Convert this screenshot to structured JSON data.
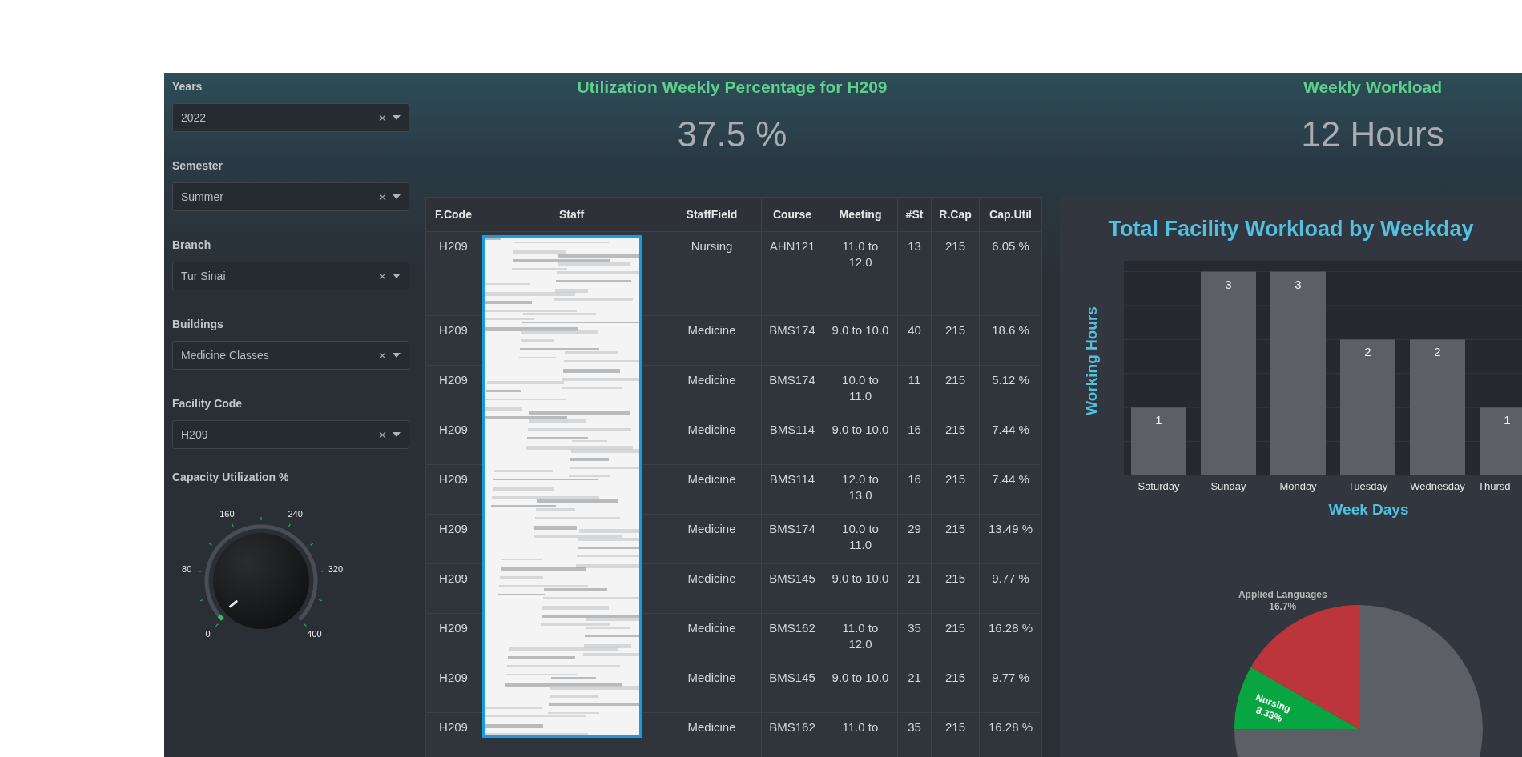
{
  "filters": [
    {
      "label": "Years",
      "value": "2022"
    },
    {
      "label": "Semester",
      "value": "Summer"
    },
    {
      "label": "Branch",
      "value": "Tur Sinai"
    },
    {
      "label": "Buildings",
      "value": "Medicine Classes"
    },
    {
      "label": "Facility Code",
      "value": "H209"
    }
  ],
  "gauge": {
    "label": "Capacity Utilization %",
    "ticks": [
      "0",
      "80",
      "160",
      "240",
      "320",
      "400"
    ],
    "level": 0.02
  },
  "kpis": [
    {
      "title": "Utilization Weekly Percentage for H209",
      "value": "37.5 %"
    },
    {
      "title": "Weekly Workload",
      "value": "12 Hours"
    }
  ],
  "table": {
    "columns": [
      {
        "label": "F.Code"
      },
      {
        "label": "Staff",
        "redacted": true
      },
      {
        "label": "StaffField"
      },
      {
        "label": "Course"
      },
      {
        "label": "Meeting"
      },
      {
        "label": "#St"
      },
      {
        "label": "R.Cap"
      },
      {
        "label": "Cap.Util"
      }
    ],
    "rows": [
      [
        "H209",
        "",
        "Nursing",
        "AHN121",
        "11.0 to 12.0",
        "13",
        "215",
        "6.05 %"
      ],
      [
        "H209",
        "",
        "Medicine",
        "BMS174",
        "9.0 to 10.0",
        "40",
        "215",
        "18.6 %"
      ],
      [
        "H209",
        "",
        "Medicine",
        "BMS174",
        "10.0 to 11.0",
        "11",
        "215",
        "5.12 %"
      ],
      [
        "H209",
        "",
        "Medicine",
        "BMS114",
        "9.0 to 10.0",
        "16",
        "215",
        "7.44 %"
      ],
      [
        "H209",
        "",
        "Medicine",
        "BMS114",
        "12.0 to 13.0",
        "16",
        "215",
        "7.44 %"
      ],
      [
        "H209",
        "",
        "Medicine",
        "BMS174",
        "10.0 to 11.0",
        "29",
        "215",
        "13.49 %"
      ],
      [
        "H209",
        "",
        "Medicine",
        "BMS145",
        "9.0 to 10.0",
        "21",
        "215",
        "9.77 %"
      ],
      [
        "H209",
        "",
        "Medicine",
        "BMS162",
        "11.0 to 12.0",
        "35",
        "215",
        "16.28 %"
      ],
      [
        "H209",
        "",
        "Medicine",
        "BMS145",
        "9.0 to 10.0",
        "21",
        "215",
        "9.77 %"
      ],
      [
        "H209",
        "",
        "Medicine",
        "BMS162",
        "11.0 to",
        "35",
        "215",
        "16.28 %"
      ]
    ]
  },
  "workload_chart": {
    "chart_data": {
      "type": "bar",
      "title": "Total Facility Workload by Weekday",
      "xlabel": "Week Days",
      "ylabel": "Working Hours",
      "categories": [
        "Saturday",
        "Sunday",
        "Monday",
        "Tuesday",
        "Wednesday",
        "Thursd"
      ],
      "series": [
        {
          "color": "#5c5f66",
          "values": [
            1,
            3,
            3,
            2,
            2,
            1
          ]
        }
      ],
      "ylim": [
        0,
        3.16
      ],
      "data_labels": true
    }
  },
  "field_chart": {
    "chart_data": {
      "type": "pie",
      "categories": [
        "Applied Languages",
        "Nursing",
        null
      ],
      "colors": [
        "#bc353b",
        "#08a543",
        "#5c5f66"
      ],
      "series": [
        {
          "values": [
            16.7,
            8.33,
            74.97
          ]
        }
      ],
      "value_labels": [
        "16.7%",
        "8.33%",
        null
      ]
    }
  }
}
